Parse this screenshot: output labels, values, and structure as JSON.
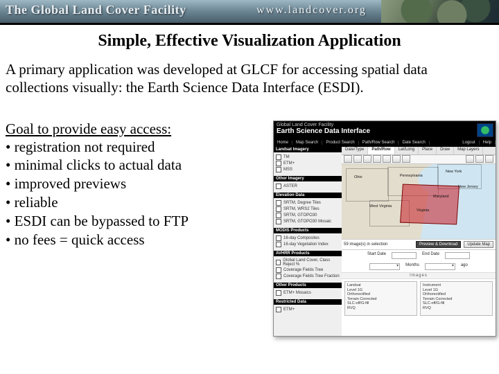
{
  "banner": {
    "title": "The Global Land Cover Facility",
    "url": "www.landcover.org"
  },
  "slide": {
    "title": "Simple, Effective Visualization Application",
    "intro": "A primary application was developed at GLCF for accessing spatial data collections visually: the Earth Science Data Interface (ESDI).",
    "goal_heading": "Goal to provide easy access:",
    "bullets": [
      "registration not required",
      "minimal clicks to actual data",
      "improved previews",
      "reliable",
      "ESDI can be bypassed to FTP",
      "no fees = quick access"
    ]
  },
  "esdi": {
    "header_line1": "Global Land Cover Facility",
    "header_line2": "Earth Science Data Interface",
    "nav": [
      "Home",
      "Map Search",
      "Product Search",
      "Path/Row Search",
      "Date Search"
    ],
    "nav_right": [
      "Logout",
      "Help"
    ],
    "tabs": [
      "Date/Type",
      "Path/Row",
      "Lat/Long",
      "Place",
      "Draw",
      "Map Layers"
    ],
    "active_tab": 1,
    "side_sections": [
      {
        "title": "Landsat Imagery",
        "items": [
          "TM",
          "ETM+",
          "MSS"
        ]
      },
      {
        "title": "Other Imagery",
        "items": [
          "ASTER"
        ]
      },
      {
        "title": "Elevation Data",
        "items": [
          "SRTM, Degree Tiles",
          "SRTM, WRS2 Tiles",
          "SRTM, GTOPO30",
          "SRTM, GTOPO30 Mosaic"
        ]
      },
      {
        "title": "MODIS Products",
        "items": [
          "16-day Composites",
          "16-day Vegetation Index"
        ]
      },
      {
        "title": "AVHRR Products",
        "items": [
          "Global Land Cover, Class Reject %",
          "Coverage Fields Tree",
          "Coverage Fields Tree Fraction"
        ]
      },
      {
        "title": "Other Products",
        "items": [
          "ETM+ Mosaics"
        ]
      },
      {
        "title": "Restricted Data",
        "items": [
          "ETM+"
        ]
      }
    ],
    "map_labels": [
      "Ohio",
      "Pennsylvania",
      "New York",
      "West Virginia",
      "Virginia",
      "Maryland",
      "New Jersey"
    ],
    "selection": {
      "count_text": "59 image(s) in selection",
      "preview_btn": "Preview & Download",
      "update_btn": "Update Map"
    },
    "date_form": {
      "start_label": "Start Date",
      "end_label": "End Date",
      "range_left": "Months",
      "range_right": "ago"
    },
    "images_label": "Images",
    "image_meta": {
      "left": [
        "Landsat",
        "Level 1G",
        "Orthorectified",
        "Terrain Corrected",
        "SLC-off/G-fill",
        "RVQ"
      ],
      "right": [
        "Instrument",
        "Level 1G",
        "Orthorectified",
        "Terrain Corrected",
        "SLC-off/G-fill",
        "RVQ"
      ]
    }
  }
}
